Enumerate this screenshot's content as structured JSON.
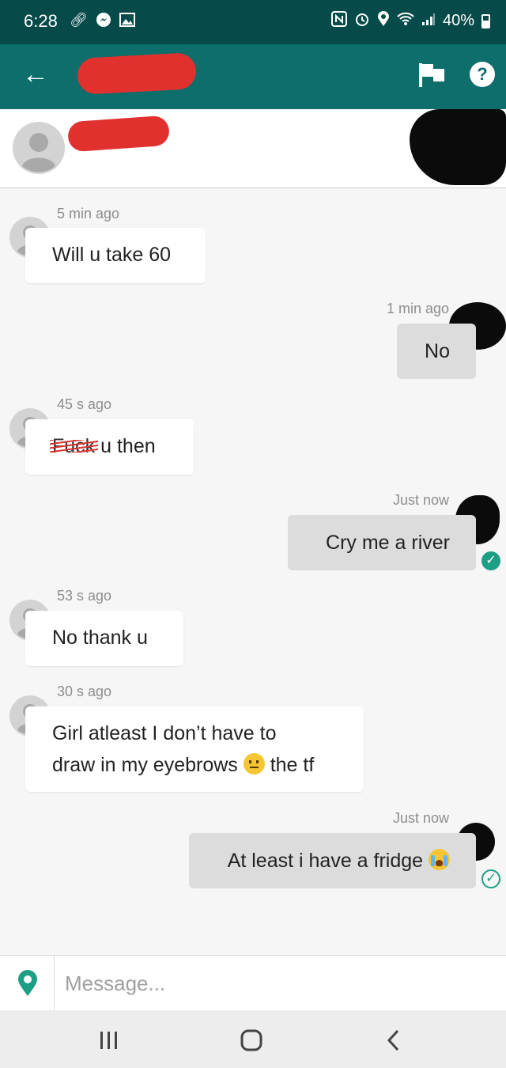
{
  "status_bar": {
    "time": "6:28",
    "battery": "40%",
    "left_icons": [
      "link-icon",
      "messenger-icon",
      "gallery-icon"
    ],
    "right_icons": [
      "nfc-icon",
      "alarm-icon",
      "location-icon",
      "wifi-icon",
      "signal-icon",
      "battery-icon"
    ]
  },
  "header": {
    "back_icon": "arrow-left-icon",
    "flag_icon": "flag-icon",
    "help_icon": "help-icon",
    "help_glyph": "?"
  },
  "conversation": {
    "messages": [
      {
        "direction": "incoming",
        "time": "5 min ago",
        "text": "Will u take 60"
      },
      {
        "direction": "outgoing",
        "time": "1 min ago",
        "text": "No"
      },
      {
        "direction": "incoming",
        "time": "45 s ago",
        "scribbled_word": "Fuck",
        "text": " u then"
      },
      {
        "direction": "outgoing",
        "time": "Just now",
        "text": "Cry me a river",
        "status": "read"
      },
      {
        "direction": "incoming",
        "time": "53 s ago",
        "text": "No thank u"
      },
      {
        "direction": "incoming",
        "time": "30 s ago",
        "line1": "Girl atleast I don’t have to",
        "line2_a": "draw in my eyebrows ",
        "line2_b": " the tf"
      },
      {
        "direction": "outgoing",
        "time": "Just now",
        "text": "At least i have a fridge ",
        "status": "delivered"
      }
    ]
  },
  "composer": {
    "placeholder": "Message...",
    "value": ""
  },
  "colors": {
    "status_bar": "#064a4a",
    "app_bar": "#0d6e6c",
    "accent": "#1d9f85",
    "redaction_red": "#e0312f"
  }
}
